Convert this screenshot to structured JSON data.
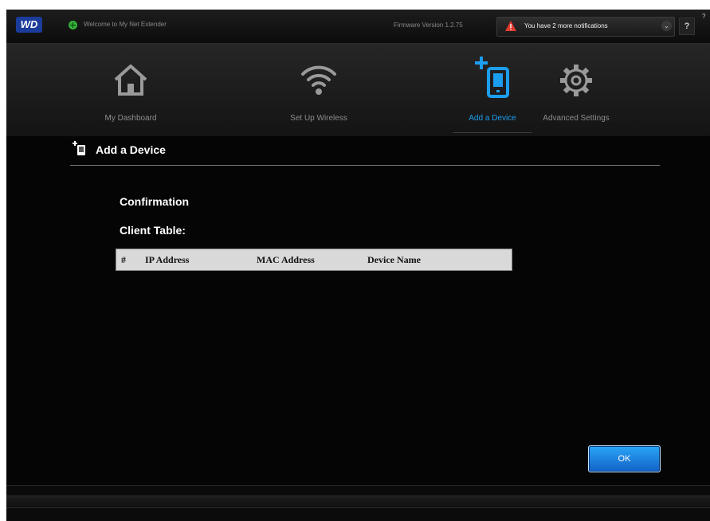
{
  "topbar": {
    "logo": "WD",
    "welcome": "Welcome to My Net Extender",
    "firmware": "Firmware Version 1.2.75",
    "notification": "You have 2 more notifications",
    "help": "?",
    "corner": "?",
    "icons": {
      "status": "status-globe-icon",
      "warning": "warning-icon",
      "chevron": "chevron-down-icon"
    },
    "colors": {
      "warning": "#e23b2e",
      "logo": "#1b3c9a"
    }
  },
  "nav": {
    "items": [
      {
        "label": "My Dashboard",
        "icon": "home-icon",
        "active": false
      },
      {
        "label": "Set Up Wireless",
        "icon": "wifi-icon",
        "active": false
      },
      {
        "label": "Add a Device",
        "icon": "add-device-icon",
        "active": true
      },
      {
        "label": "Advanced Settings",
        "icon": "gear-icon",
        "active": false
      }
    ],
    "active_color": "#1c9ef0"
  },
  "page": {
    "title": "Add a Device",
    "section": "Confirmation",
    "table_title": "Client Table:"
  },
  "client_table": {
    "columns": [
      "#",
      "IP Address",
      "MAC Address",
      "Device Name"
    ],
    "rows": []
  },
  "buttons": {
    "ok": "OK",
    "ok_color": "#1a86e6"
  }
}
